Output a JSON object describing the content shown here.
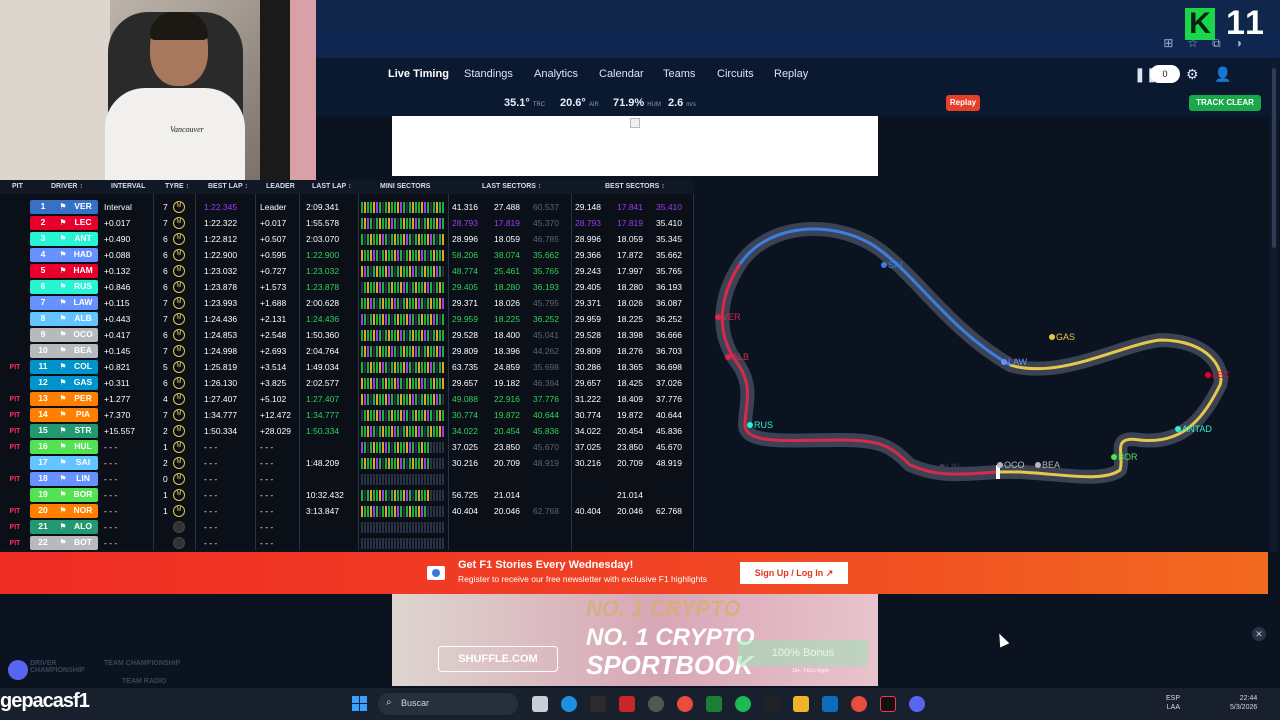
{
  "browser": {
    "k_logo": "K",
    "k_number": "11"
  },
  "nav": {
    "items": [
      "Live Timing",
      "Standings",
      "Analytics",
      "Calendar",
      "Teams",
      "Circuits",
      "Replay"
    ],
    "counter": "0"
  },
  "weather": {
    "track_temp": "35.1°",
    "track_unit": "TRC",
    "air_temp": "20.6°",
    "air_unit": "AIR",
    "humidity": "71.9%",
    "hum_unit": "HUM",
    "wind": "2.6",
    "wind_unit": "m/s"
  },
  "buttons": {
    "replay": "Replay",
    "track_clear": "TRACK CLEAR"
  },
  "table": {
    "headers": {
      "pit": "PIT",
      "driver": "DRIVER",
      "interval": "INTERVAL",
      "tyre": "TYRE",
      "best_lap": "BEST LAP",
      "leader": "LEADER",
      "last_lap": "LAST LAP",
      "mini_sectors": "MINI SECTORS",
      "last_sectors": "LAST SECTORS",
      "best_sectors": "BEST SECTORS"
    },
    "rows": [
      {
        "pit": "",
        "pos": "1",
        "code": "VER",
        "team_color": "#3671c6",
        "interval": "Interval",
        "laps": "7",
        "tyre": "M",
        "best": "1:22.345",
        "leader": "Leader",
        "last": "2:09.341",
        "ls1": "41.316",
        "ls2": "27.488",
        "ls3": "60.537",
        "bs1": "29.148",
        "bs2": "17.841",
        "bs3": "35.410"
      },
      {
        "pit": "",
        "pos": "2",
        "code": "LEC",
        "team_color": "#e8002d",
        "interval": "+0.017",
        "laps": "7",
        "tyre": "M",
        "best": "1:22.322",
        "leader": "+0.017",
        "last": "1:55.578",
        "ls1": "28.793",
        "ls2": "17.819",
        "ls3": "45.370",
        "bs1": "28.793",
        "bs2": "17.819",
        "bs3": "35.410"
      },
      {
        "pit": "",
        "pos": "3",
        "code": "ANT",
        "team_color": "#27f4d2",
        "interval": "+0.490",
        "laps": "6",
        "tyre": "M",
        "best": "1:22.812",
        "leader": "+0.507",
        "last": "2:03.070",
        "ls1": "28.996",
        "ls2": "18.059",
        "ls3": "46.785",
        "bs1": "28.996",
        "bs2": "18.059",
        "bs3": "35.345"
      },
      {
        "pit": "",
        "pos": "4",
        "code": "HAD",
        "team_color": "#6692ff",
        "interval": "+0.088",
        "laps": "6",
        "tyre": "M",
        "best": "1:22.900",
        "leader": "+0.595",
        "last": "1:22.900",
        "ls1": "58.206",
        "ls2": "38.074",
        "ls3": "35.662",
        "bs1": "29.366",
        "bs2": "17.872",
        "bs3": "35.662"
      },
      {
        "pit": "",
        "pos": "5",
        "code": "HAM",
        "team_color": "#e8002d",
        "interval": "+0.132",
        "laps": "6",
        "tyre": "M",
        "best": "1:23.032",
        "leader": "+0.727",
        "last": "1:23.032",
        "ls1": "48.774",
        "ls2": "25.461",
        "ls3": "35.765",
        "bs1": "29.243",
        "bs2": "17.997",
        "bs3": "35.765"
      },
      {
        "pit": "",
        "pos": "6",
        "code": "RUS",
        "team_color": "#27f4d2",
        "interval": "+0.846",
        "laps": "6",
        "tyre": "M",
        "best": "1:23.878",
        "leader": "+1.573",
        "last": "1:23.878",
        "ls1": "29.405",
        "ls2": "18.280",
        "ls3": "36.193",
        "bs1": "29.405",
        "bs2": "18.280",
        "bs3": "36.193"
      },
      {
        "pit": "",
        "pos": "7",
        "code": "LAW",
        "team_color": "#6692ff",
        "interval": "+0.115",
        "laps": "7",
        "tyre": "M",
        "best": "1:23.993",
        "leader": "+1.688",
        "last": "2:00.628",
        "ls1": "29.371",
        "ls2": "18.026",
        "ls3": "45.795",
        "bs1": "29.371",
        "bs2": "18.026",
        "bs3": "36.087"
      },
      {
        "pit": "",
        "pos": "8",
        "code": "ALB",
        "team_color": "#64c4ff",
        "interval": "+0.443",
        "laps": "7",
        "tyre": "M",
        "best": "1:24.436",
        "leader": "+2.131",
        "last": "1:24.436",
        "ls1": "29.959",
        "ls2": "18.225",
        "ls3": "36.252",
        "bs1": "29.959",
        "bs2": "18.225",
        "bs3": "36.252"
      },
      {
        "pit": "",
        "pos": "9",
        "code": "OCO",
        "team_color": "#b6babd",
        "interval": "+0.417",
        "laps": "6",
        "tyre": "M",
        "best": "1:24.853",
        "leader": "+2.548",
        "last": "1:50.360",
        "ls1": "29.528",
        "ls2": "18.400",
        "ls3": "45.041",
        "bs1": "29.528",
        "bs2": "18.398",
        "bs3": "36.666"
      },
      {
        "pit": "",
        "pos": "10",
        "code": "BEA",
        "team_color": "#b6babd",
        "interval": "+0.145",
        "laps": "7",
        "tyre": "M",
        "best": "1:24.998",
        "leader": "+2.693",
        "last": "2:04.764",
        "ls1": "29.809",
        "ls2": "18.396",
        "ls3": "44.262",
        "bs1": "29.809",
        "bs2": "18.276",
        "bs3": "36.703"
      },
      {
        "pit": "PIT",
        "pos": "11",
        "code": "COL",
        "team_color": "#0093cc",
        "interval": "+0.821",
        "laps": "5",
        "tyre": "M",
        "best": "1:25.819",
        "leader": "+3.514",
        "last": "1:49.034",
        "ls1": "63.735",
        "ls2": "24.859",
        "ls3": "35.698",
        "bs1": "30.286",
        "bs2": "18.365",
        "bs3": "36.698"
      },
      {
        "pit": "",
        "pos": "12",
        "code": "GAS",
        "team_color": "#0093cc",
        "interval": "+0.311",
        "laps": "6",
        "tyre": "M",
        "best": "1:26.130",
        "leader": "+3.825",
        "last": "2:02.577",
        "ls1": "29.657",
        "ls2": "19.182",
        "ls3": "46.364",
        "bs1": "29.657",
        "bs2": "18.425",
        "bs3": "37.026"
      },
      {
        "pit": "PIT",
        "pos": "13",
        "code": "PER",
        "team_color": "#ff8000",
        "interval": "+1.277",
        "laps": "4",
        "tyre": "M",
        "best": "1:27.407",
        "leader": "+5.102",
        "last": "1:27.407",
        "ls1": "49.088",
        "ls2": "22.916",
        "ls3": "37.776",
        "bs1": "31.222",
        "bs2": "18.409",
        "bs3": "37.776"
      },
      {
        "pit": "PIT",
        "pos": "14",
        "code": "PIA",
        "team_color": "#ff8000",
        "interval": "+7.370",
        "laps": "7",
        "tyre": "M",
        "best": "1:34.777",
        "leader": "+12.472",
        "last": "1:34.777",
        "ls1": "30.774",
        "ls2": "19.872",
        "ls3": "40.644",
        "bs1": "30.774",
        "bs2": "19.872",
        "bs3": "40.644"
      },
      {
        "pit": "PIT",
        "pos": "15",
        "code": "STR",
        "team_color": "#229971",
        "interval": "+15.557",
        "laps": "2",
        "tyre": "M",
        "best": "1:50.334",
        "leader": "+28.029",
        "last": "1:50.334",
        "ls1": "34.022",
        "ls2": "20.454",
        "ls3": "45.836",
        "bs1": "34.022",
        "bs2": "20.454",
        "bs3": "45.836"
      },
      {
        "pit": "PIT",
        "pos": "16",
        "code": "HUL",
        "team_color": "#52e252",
        "interval": "- - -",
        "laps": "1",
        "tyre": "M",
        "best": "- - -",
        "leader": "- - -",
        "last": "",
        "ls1": "37.025",
        "ls2": "23.850",
        "ls3": "45.670",
        "bs1": "37.025",
        "bs2": "23.850",
        "bs3": "45.670"
      },
      {
        "pit": "",
        "pos": "17",
        "code": "SAI",
        "team_color": "#64c4ff",
        "interval": "- - -",
        "laps": "2",
        "tyre": "M",
        "best": "- - -",
        "leader": "- - -",
        "last": "1:48.209",
        "ls1": "30.216",
        "ls2": "20.709",
        "ls3": "48.919",
        "bs1": "30.216",
        "bs2": "20.709",
        "bs3": "48.919"
      },
      {
        "pit": "PIT",
        "pos": "18",
        "code": "LIN",
        "team_color": "#6692ff",
        "interval": "- - -",
        "laps": "0",
        "tyre": "M",
        "best": "- - -",
        "leader": "- - -",
        "last": "",
        "ls1": "",
        "ls2": "",
        "ls3": "",
        "bs1": "",
        "bs2": "",
        "bs3": ""
      },
      {
        "pit": "",
        "pos": "19",
        "code": "BOR",
        "team_color": "#52e252",
        "interval": "- - -",
        "laps": "1",
        "tyre": "M",
        "best": "- - -",
        "leader": "- - -",
        "last": "10:32.432",
        "ls1": "56.725",
        "ls2": "21.014",
        "ls3": "",
        "bs1": "",
        "bs2": "21.014",
        "bs3": ""
      },
      {
        "pit": "PIT",
        "pos": "20",
        "code": "NOR",
        "team_color": "#ff8000",
        "interval": "- - -",
        "laps": "1",
        "tyre": "M",
        "best": "- - -",
        "leader": "- - -",
        "last": "3:13.847",
        "ls1": "40.404",
        "ls2": "20.046",
        "ls3": "62.768",
        "bs1": "40.404",
        "bs2": "20.046",
        "bs3": "62.768"
      },
      {
        "pit": "PIT",
        "pos": "21",
        "code": "ALO",
        "team_color": "#229971",
        "interval": "- - -",
        "laps": "",
        "tyre": "",
        "best": "- - -",
        "leader": "- - -",
        "last": "",
        "ls1": "",
        "ls2": "",
        "ls3": "",
        "bs1": "",
        "bs2": "",
        "bs3": ""
      },
      {
        "pit": "PIT",
        "pos": "22",
        "code": "BOT",
        "team_color": "#b6babd",
        "interval": "- - -",
        "laps": "",
        "tyre": "",
        "best": "- - -",
        "leader": "- - -",
        "last": "",
        "ls1": "",
        "ls2": "",
        "ls3": "",
        "bs1": "",
        "bs2": "",
        "bs3": ""
      }
    ]
  },
  "track_labels": [
    "SAI",
    "VER",
    "ALB",
    "RUS",
    "GAS",
    "LAW",
    "LEC",
    "ANTAD",
    "BOR",
    "OCO",
    "BEA",
    "LIN"
  ],
  "banner": {
    "title": "Get F1 Stories Every Wednesday!",
    "subtitle": "Register to receive our free newsletter with exclusive F1 highlights",
    "signup": "Sign Up / Log In ↗"
  },
  "ad_bottom": {
    "line1": "NO. 1 CRYPTO",
    "line2": "NO. 1 CRYPTO",
    "line3": "SPORTBOOK",
    "brand": "SHUFFLE.COM",
    "bonus": "100% Bonus",
    "small": "18+. T&Cs Apply"
  },
  "bottom_tabs": {
    "driver": "DRIVER",
    "championship": "CHAMPIONSHIP",
    "team": "TEAM CHAMPIONSHIP",
    "radio": "TEAM RADIO"
  },
  "taskbar": {
    "watermark": "gepacasf1",
    "search": "Buscar",
    "lang": "ESP",
    "lang2": "LAA",
    "time": "22:44",
    "date": "5/3/2026"
  }
}
